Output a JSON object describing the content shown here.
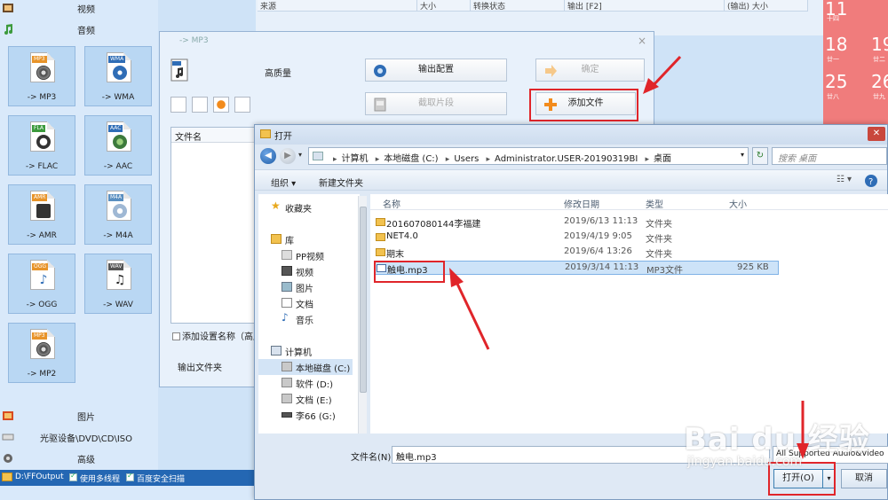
{
  "left_panel": {
    "categories": [
      {
        "label": "视频"
      },
      {
        "label": "音频"
      }
    ],
    "tiles": [
      {
        "tag": "MP3",
        "label": "-> MP3",
        "tag_color": "#e8942a"
      },
      {
        "tag": "WMA",
        "label": "-> WMA",
        "tag_color": "#2f6db6"
      },
      {
        "tag": "FLA",
        "label": "-> FLAC",
        "tag_color": "#3c9a3c"
      },
      {
        "tag": "AAC",
        "label": "-> AAC",
        "tag_color": "#2f6db6"
      },
      {
        "tag": "AMR",
        "label": "-> AMR",
        "tag_color": "#e8942a"
      },
      {
        "tag": "M4A",
        "label": "-> M4A",
        "tag_color": "#5a8fc0"
      },
      {
        "tag": "OGG",
        "label": "-> OGG",
        "tag_color": "#e8942a"
      },
      {
        "tag": "WAV",
        "label": "-> WAV",
        "tag_color": "#555555"
      },
      {
        "tag": "MP3",
        "label": "-> MP2",
        "tag_color": "#e8942a"
      }
    ],
    "bottom_categories": [
      {
        "label": "图片"
      },
      {
        "label": "光驱设备\\DVD\\CD\\ISO"
      },
      {
        "label": "高级"
      }
    ]
  },
  "list_header": {
    "cols": [
      "来源",
      "大小",
      "转换状态",
      "输出 [F2]",
      "(输出) 大小"
    ]
  },
  "calendar": {
    "days": [
      "11",
      "18",
      "19",
      "25",
      "26"
    ],
    "lunars": [
      "十四",
      "廿一",
      "廿二",
      "廿八",
      "廿九"
    ]
  },
  "statusbar": {
    "output_path": "D:\\FFOutput",
    "multithread": "使用多线程",
    "safe_scan": "百度安全扫描"
  },
  "mp3_dialog": {
    "title": "-> MP3",
    "close": "×",
    "quality": "高质量",
    "output_config": "输出配置",
    "ok": "确定",
    "clip": "截取片段",
    "add_file": "添加文件",
    "file_list_header": "文件名",
    "set_name": "添加设置名称（高质",
    "output_folder": "输出文件夹"
  },
  "open_dialog": {
    "title": "打开",
    "close": "✕",
    "path": [
      "计算机",
      "本地磁盘 (C:)",
      "Users",
      "Administrator.USER-20190319BI",
      "桌面"
    ],
    "search_placeholder": "搜索 桌面",
    "toolbar": {
      "organize": "组织 ▾",
      "new_folder": "新建文件夹"
    },
    "nav": {
      "favorites": "收藏夹",
      "library": "库",
      "library_items": [
        "PP视频",
        "视频",
        "图片",
        "文档",
        "音乐"
      ],
      "computer": "计算机",
      "drives": [
        "本地磁盘 (C:)",
        "软件 (D:)",
        "文档 (E:)",
        "李66 (G:)"
      ]
    },
    "columns": {
      "name": "名称",
      "modified": "修改日期",
      "type": "类型",
      "size": "大小"
    },
    "files": [
      {
        "name": "201607080144李福建",
        "modified": "2019/6/13 11:13",
        "type": "文件夹",
        "size": ""
      },
      {
        "name": "NET4.0",
        "modified": "2019/4/19 9:05",
        "type": "文件夹",
        "size": ""
      },
      {
        "name": "期末",
        "modified": "2019/6/4 13:26",
        "type": "文件夹",
        "size": ""
      },
      {
        "name": "触电.mp3",
        "modified": "2019/3/14 11:13",
        "type": "MP3文件",
        "size": "925 KB"
      }
    ],
    "filename_label": "文件名(N):",
    "filename_value": "触电.mp3",
    "filetype_value": "All Supported Audio&Video",
    "open_button": "打开(O)",
    "cancel_button": "取消"
  },
  "watermark": {
    "brand": "Bai du 经验",
    "url": "jingyan.baidu.com"
  },
  "colors": {
    "highlight": "#e0252a",
    "calendar": "#f07c7c",
    "status": "#2467b3"
  }
}
